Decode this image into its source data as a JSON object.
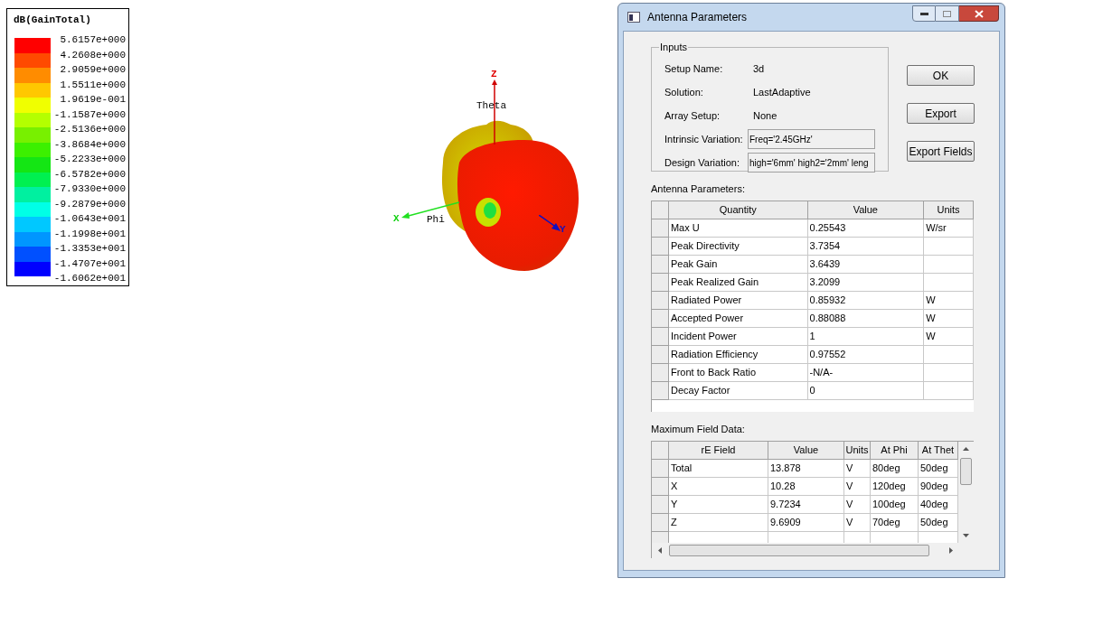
{
  "legend": {
    "title": "dB(GainTotal)",
    "bands": [
      {
        "color": "#ff0000"
      },
      {
        "color": "#ff4a00"
      },
      {
        "color": "#ff8c00"
      },
      {
        "color": "#ffc800"
      },
      {
        "color": "#f0ff00"
      },
      {
        "color": "#b4ff00"
      },
      {
        "color": "#78f000"
      },
      {
        "color": "#3cf000"
      },
      {
        "color": "#14e614"
      },
      {
        "color": "#00f050"
      },
      {
        "color": "#00f0a0"
      },
      {
        "color": "#00ffe6"
      },
      {
        "color": "#00c8ff"
      },
      {
        "color": "#0096ff"
      },
      {
        "color": "#0050ff"
      },
      {
        "color": "#0000ff"
      }
    ],
    "labels": [
      "5.6157e+000",
      "4.2608e+000",
      "2.9059e+000",
      "1.5511e+000",
      "1.9619e-001",
      "-1.1587e+000",
      "-2.5136e+000",
      "-3.8684e+000",
      "-5.2233e+000",
      "-6.5782e+000",
      "-7.9330e+000",
      "-9.2879e+000",
      "-1.0643e+001",
      "-1.1998e+001",
      "-1.3353e+001",
      "-1.4707e+001",
      "-1.6062e+001"
    ]
  },
  "plot": {
    "axes": {
      "z": "Z",
      "theta": "Theta",
      "x": "X",
      "phi": "Phi",
      "y": "Y"
    }
  },
  "dialog": {
    "title": "Antenna Parameters",
    "inputs": {
      "title": "Inputs",
      "fields": [
        {
          "label": "Setup Name:",
          "value": "3d",
          "kind": "text"
        },
        {
          "label": "Solution:",
          "value": "LastAdaptive",
          "kind": "text"
        },
        {
          "label": "Array Setup:",
          "value": "None",
          "kind": "text"
        },
        {
          "label": "Intrinsic Variation:",
          "value": "Freq='2.45GHz'",
          "kind": "field"
        },
        {
          "label": "Design Variation:",
          "value": "high='6mm' high2='2mm' leng",
          "kind": "field"
        }
      ]
    },
    "buttons": [
      "OK",
      "Export",
      "Export Fields"
    ],
    "antenna_parameters": {
      "title": "Antenna Parameters:",
      "columns": [
        "Quantity",
        "Value",
        "Units"
      ],
      "rows": [
        [
          "Max U",
          "0.25543",
          "W/sr"
        ],
        [
          "Peak Directivity",
          "3.7354",
          ""
        ],
        [
          "Peak Gain",
          "3.6439",
          ""
        ],
        [
          "Peak Realized Gain",
          "3.2099",
          ""
        ],
        [
          "Radiated Power",
          "0.85932",
          "W"
        ],
        [
          "Accepted Power",
          "0.88088",
          "W"
        ],
        [
          "Incident Power",
          "1",
          "W"
        ],
        [
          "Radiation Efficiency",
          "0.97552",
          ""
        ],
        [
          "Front to Back Ratio",
          "-N/A-",
          ""
        ],
        [
          "Decay Factor",
          "0",
          ""
        ]
      ]
    },
    "max_field": {
      "title": "Maximum Field Data:",
      "columns": [
        "rE Field",
        "Value",
        "Units",
        "At Phi",
        "At Thet"
      ],
      "rows": [
        [
          "Total",
          "13.878",
          "V",
          "80deg",
          "50deg"
        ],
        [
          "X",
          "10.28",
          "V",
          "120deg",
          "90deg"
        ],
        [
          "Y",
          "9.7234",
          "V",
          "100deg",
          "40deg"
        ],
        [
          "Z",
          "9.6909",
          "V",
          "70deg",
          "50deg"
        ]
      ]
    }
  }
}
